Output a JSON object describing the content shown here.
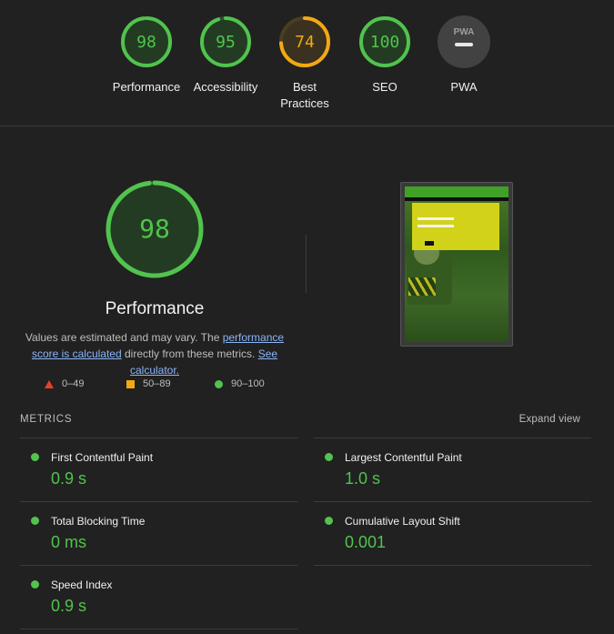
{
  "colors": {
    "good": "#51c34e",
    "average": "#f2a914",
    "poor": "#e3412c",
    "pwa": "#9e9e9e"
  },
  "gauges": [
    {
      "label": "Performance",
      "score": "98",
      "value": 98,
      "status": "good"
    },
    {
      "label": "Accessibility",
      "score": "95",
      "value": 95,
      "status": "good"
    },
    {
      "label": "Best Practices",
      "score": "74",
      "value": 74,
      "status": "average"
    },
    {
      "label": "SEO",
      "score": "100",
      "value": 100,
      "status": "good"
    },
    {
      "label": "PWA",
      "badge": "PWA",
      "status": "pwa"
    }
  ],
  "performance": {
    "score": "98",
    "value": 98,
    "title": "Performance",
    "desc_prefix": "Values are estimated and may vary. The ",
    "desc_link1": "performance score is calculated",
    "desc_middle": " directly from these metrics. ",
    "desc_link2": "See calculator."
  },
  "legend": {
    "poor": "0–49",
    "average": "50–89",
    "good": "90–100"
  },
  "metrics": {
    "title": "METRICS",
    "expand": "Expand view",
    "items": [
      {
        "label": "First Contentful Paint",
        "value": "0.9 s"
      },
      {
        "label": "Largest Contentful Paint",
        "value": "1.0 s"
      },
      {
        "label": "Total Blocking Time",
        "value": "0 ms"
      },
      {
        "label": "Cumulative Layout Shift",
        "value": "0.001"
      },
      {
        "label": "Speed Index",
        "value": "0.9 s"
      }
    ]
  }
}
